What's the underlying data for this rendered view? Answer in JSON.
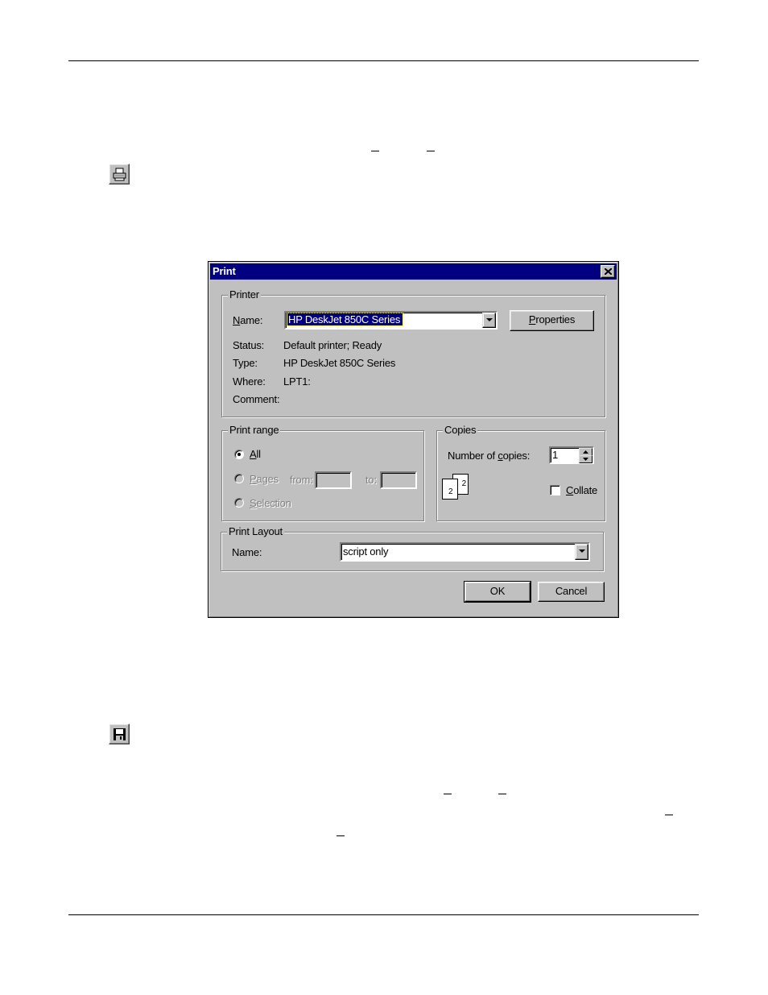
{
  "dialog": {
    "title": "Print",
    "printer_group": {
      "legend": "Printer",
      "name_label_pre": "",
      "name_label_acc": "N",
      "name_label_post": "ame:",
      "name_value": "HP DeskJet 850C Series",
      "properties_pre": "",
      "properties_acc": "P",
      "properties_post": "roperties",
      "status_label": "Status:",
      "status_value": "Default printer; Ready",
      "type_label": "Type:",
      "type_value": "HP DeskJet 850C Series",
      "where_label": "Where:",
      "where_value": "LPT1:",
      "comment_label": "Comment:",
      "comment_value": ""
    },
    "range_group": {
      "legend": "Print range",
      "all_acc": "A",
      "all_post": "ll",
      "all_selected": true,
      "pages_acc": "P",
      "pages_post": "ages",
      "from_label": "from:",
      "to_label": "to:",
      "from_value": "",
      "to_value": "",
      "selection_acc": "S",
      "selection_post": "election"
    },
    "copies_group": {
      "legend": "Copies",
      "number_pre": "Number of ",
      "number_acc": "c",
      "number_post": "opies:",
      "copies_value": "1",
      "collate_pre": "",
      "collate_acc": "C",
      "collate_post": "ollate",
      "collate_checked": false,
      "page_icon_1": "2",
      "page_icon_2": "2"
    },
    "layout_group": {
      "legend": "Print Layout",
      "name_label": "Name:",
      "name_value": "script only"
    },
    "ok_label": "OK",
    "cancel_label": "Cancel"
  },
  "icons": {
    "toolbar_print": "printer-icon",
    "toolbar_save": "floppy-disk-icon",
    "close": "close-icon"
  },
  "colors": {
    "titlebar": "#000080",
    "face": "#c0c0c0"
  }
}
